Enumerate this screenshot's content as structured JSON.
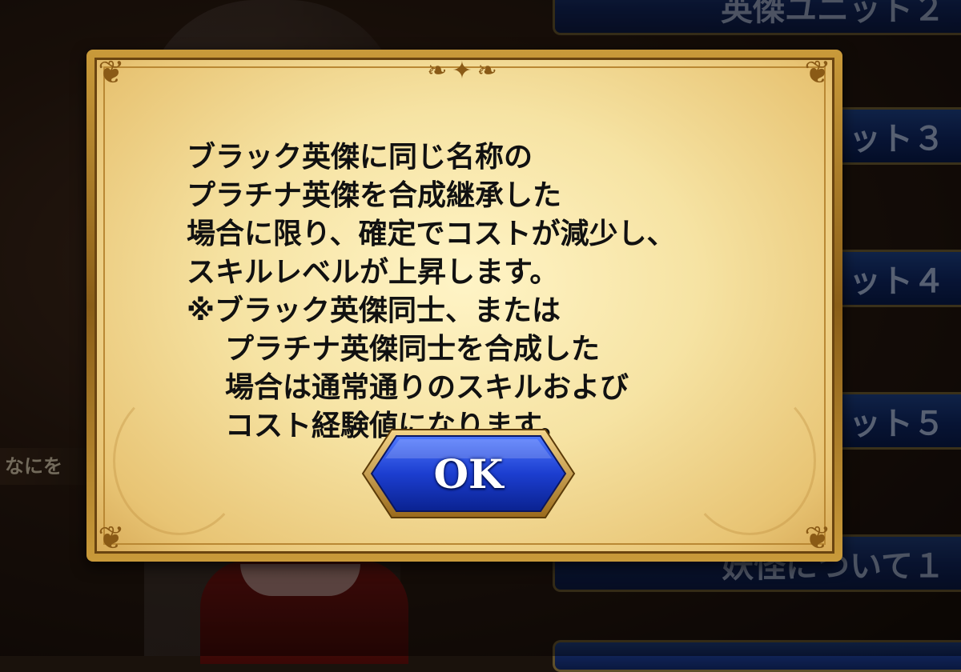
{
  "background": {
    "left_label": "なにを",
    "menu_buttons": [
      {
        "label": "英傑ユニット２"
      },
      {
        "label": "ット３"
      },
      {
        "label": "ット４"
      },
      {
        "label": "ット５"
      },
      {
        "label": "妖怪について１"
      }
    ]
  },
  "dialog": {
    "lines": [
      "ブラック英傑に同じ名称の",
      "プラチナ英傑を合成継承した",
      "場合に限り、確定でコストが減少し、",
      "スキルレベルが上昇します。",
      "※ブラック英傑同士、または",
      "プラチナ英傑同士を合成した",
      "場合は通常通りのスキルおよび",
      "コスト経験値になります。"
    ],
    "ok_label": "OK"
  },
  "colors": {
    "ok_button": "#1c3ed0",
    "parchment": "#f6e3a3",
    "frame_gold": "#c99a3a",
    "menu_blue": "#0e2560"
  }
}
